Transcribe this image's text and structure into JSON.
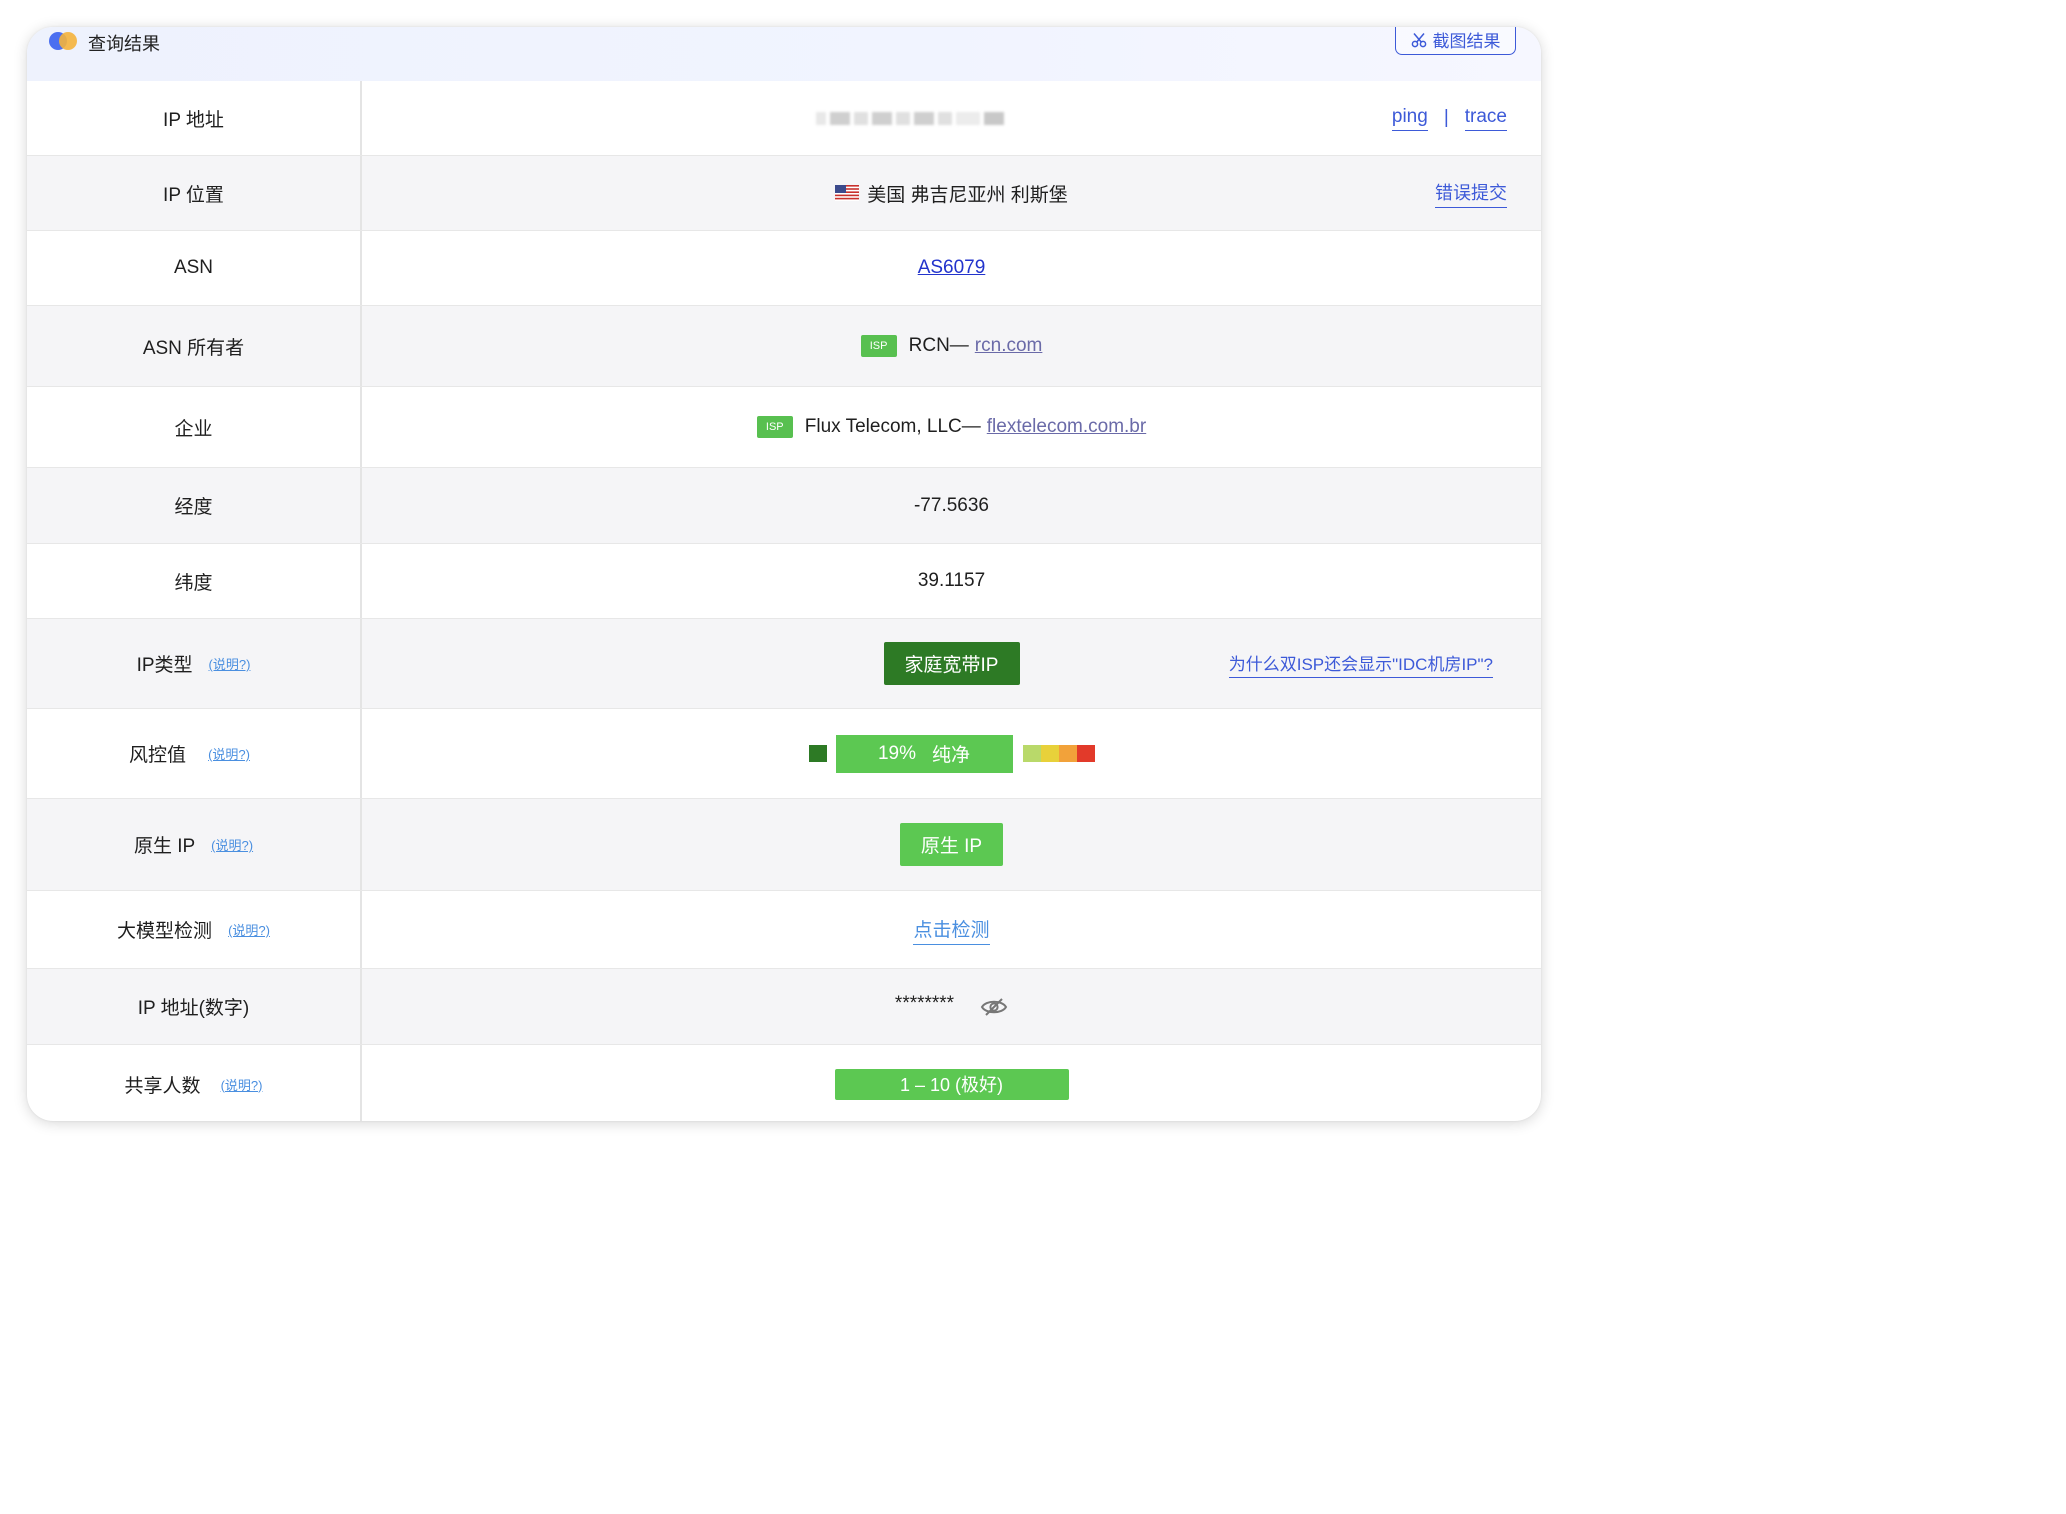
{
  "header": {
    "title": "查询结果",
    "screenshot_button": "截图结果"
  },
  "rows": {
    "ip_address": {
      "label": "IP 地址",
      "ping": "ping",
      "separator": "|",
      "trace": "trace"
    },
    "ip_location": {
      "label": "IP 位置",
      "value": "美国 弗吉尼亚州 利斯堡",
      "report_error": "错误提交"
    },
    "asn": {
      "label": "ASN",
      "value": "AS6079"
    },
    "asn_owner": {
      "label": "ASN 所有者",
      "badge": "ISP",
      "name": "RCN—",
      "domain": "rcn.com"
    },
    "company": {
      "label": "企业",
      "badge": "ISP",
      "name": "Flux Telecom, LLC—",
      "domain": "flextelecom.com.br"
    },
    "longitude": {
      "label": "经度",
      "value": "-77.5636"
    },
    "latitude": {
      "label": "纬度",
      "value": "39.1157"
    },
    "ip_type": {
      "label": "IP类型",
      "help": "(说明?)",
      "tag": "家庭宽带IP",
      "question_link": "为什么双ISP还会显示\"IDC机房IP\"?"
    },
    "risk_score": {
      "label": "风控值",
      "help": "(说明?)",
      "value": "19%",
      "status": "纯净",
      "fill_fraction": 0.19
    },
    "native_ip": {
      "label": "原生 IP",
      "help": "(说明?)",
      "tag": "原生 IP"
    },
    "llm_detect": {
      "label": "大模型检测",
      "help": "(说明?)",
      "action": "点击检测"
    },
    "ip_numeric": {
      "label": "IP 地址(数字)",
      "value": "********"
    },
    "shared_users": {
      "label": "共享人数",
      "help": "(说明?)",
      "value": "1 – 10 (极好)"
    }
  },
  "colors": {
    "accent_blue": "#3d5ad8",
    "isp_green": "#58c050",
    "dark_green": "#2d7a25",
    "bright_green": "#5cc852",
    "risk_scale": [
      "#b9d96a",
      "#e8d13a",
      "#f2a23a",
      "#e23a2a"
    ]
  },
  "icons": {
    "logo": "logo-icon",
    "scissors": "scissors-icon",
    "flag": "us-flag-icon",
    "eye_off": "eye-off-icon"
  }
}
